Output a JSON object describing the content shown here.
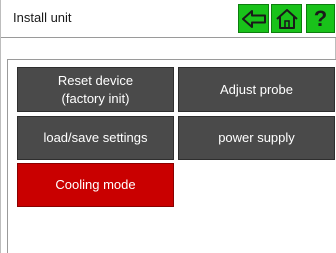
{
  "header": {
    "title": "Install unit",
    "nav": {
      "back_icon": "arrow-left-icon",
      "home_icon": "home-icon",
      "help_icon": "question-mark-icon",
      "help_label": "?",
      "button_color": "#19c21a"
    }
  },
  "menu": {
    "items": [
      {
        "label": "Reset device\n(factory init)",
        "state": "normal"
      },
      {
        "label": "Adjust probe",
        "state": "normal"
      },
      {
        "label": "load/save settings",
        "state": "normal"
      },
      {
        "label": "power supply",
        "state": "normal"
      },
      {
        "label": "Cooling mode",
        "state": "highlighted"
      }
    ],
    "tile_color": "#4a4a4a",
    "highlight_color": "#c90000"
  }
}
